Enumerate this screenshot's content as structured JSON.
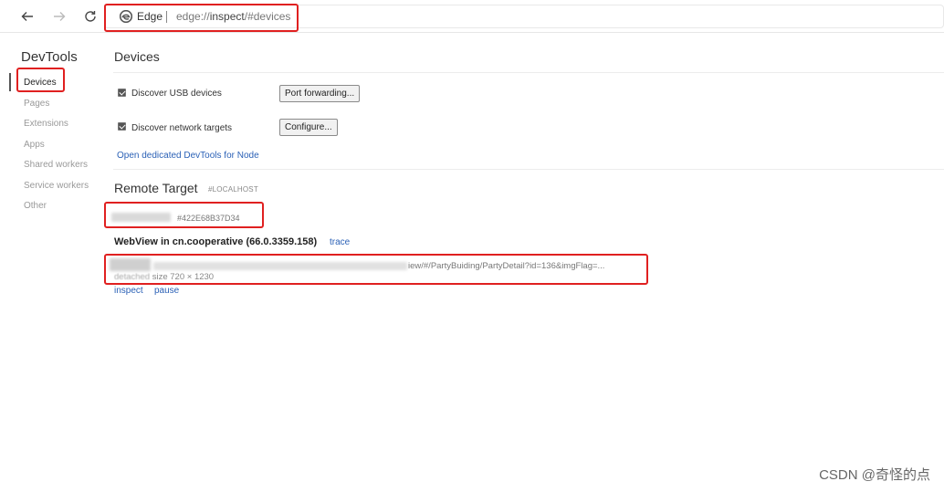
{
  "browser": {
    "brand": "Edge",
    "url_prefix": "edge://",
    "url_host": "inspect",
    "url_rest": "/#devices"
  },
  "sidebar": {
    "title": "DevTools",
    "items": [
      {
        "label": "Devices"
      },
      {
        "label": "Pages"
      },
      {
        "label": "Extensions"
      },
      {
        "label": "Apps"
      },
      {
        "label": "Shared workers"
      },
      {
        "label": "Service workers"
      },
      {
        "label": "Other"
      }
    ]
  },
  "devices": {
    "heading": "Devices",
    "usb_label": "Discover USB devices",
    "usb_checked": true,
    "port_forwarding_button": "Port forwarding...",
    "network_label": "Discover network targets",
    "network_checked": true,
    "configure_button": "Configure...",
    "node_link": "Open dedicated DevTools for Node"
  },
  "remote": {
    "heading": "Remote Target",
    "subheading": "#LOCALHOST",
    "device_id": "#422E68B37D34",
    "webview_title": "WebView in cn.cooperative (66.0.3359.158)",
    "trace_link": "trace",
    "page_url_visible": "iew/#/PartyBuiding/PartyDetail?id=136&imgFlag=...",
    "page_meta_attached": "detached",
    "page_meta_size": "size 720 × 1230",
    "inspect_link": "inspect",
    "pause_link": "pause"
  },
  "watermark": "CSDN @奇怪的点",
  "colors": {
    "annotation": "#e02020",
    "link": "#2b61b6"
  }
}
